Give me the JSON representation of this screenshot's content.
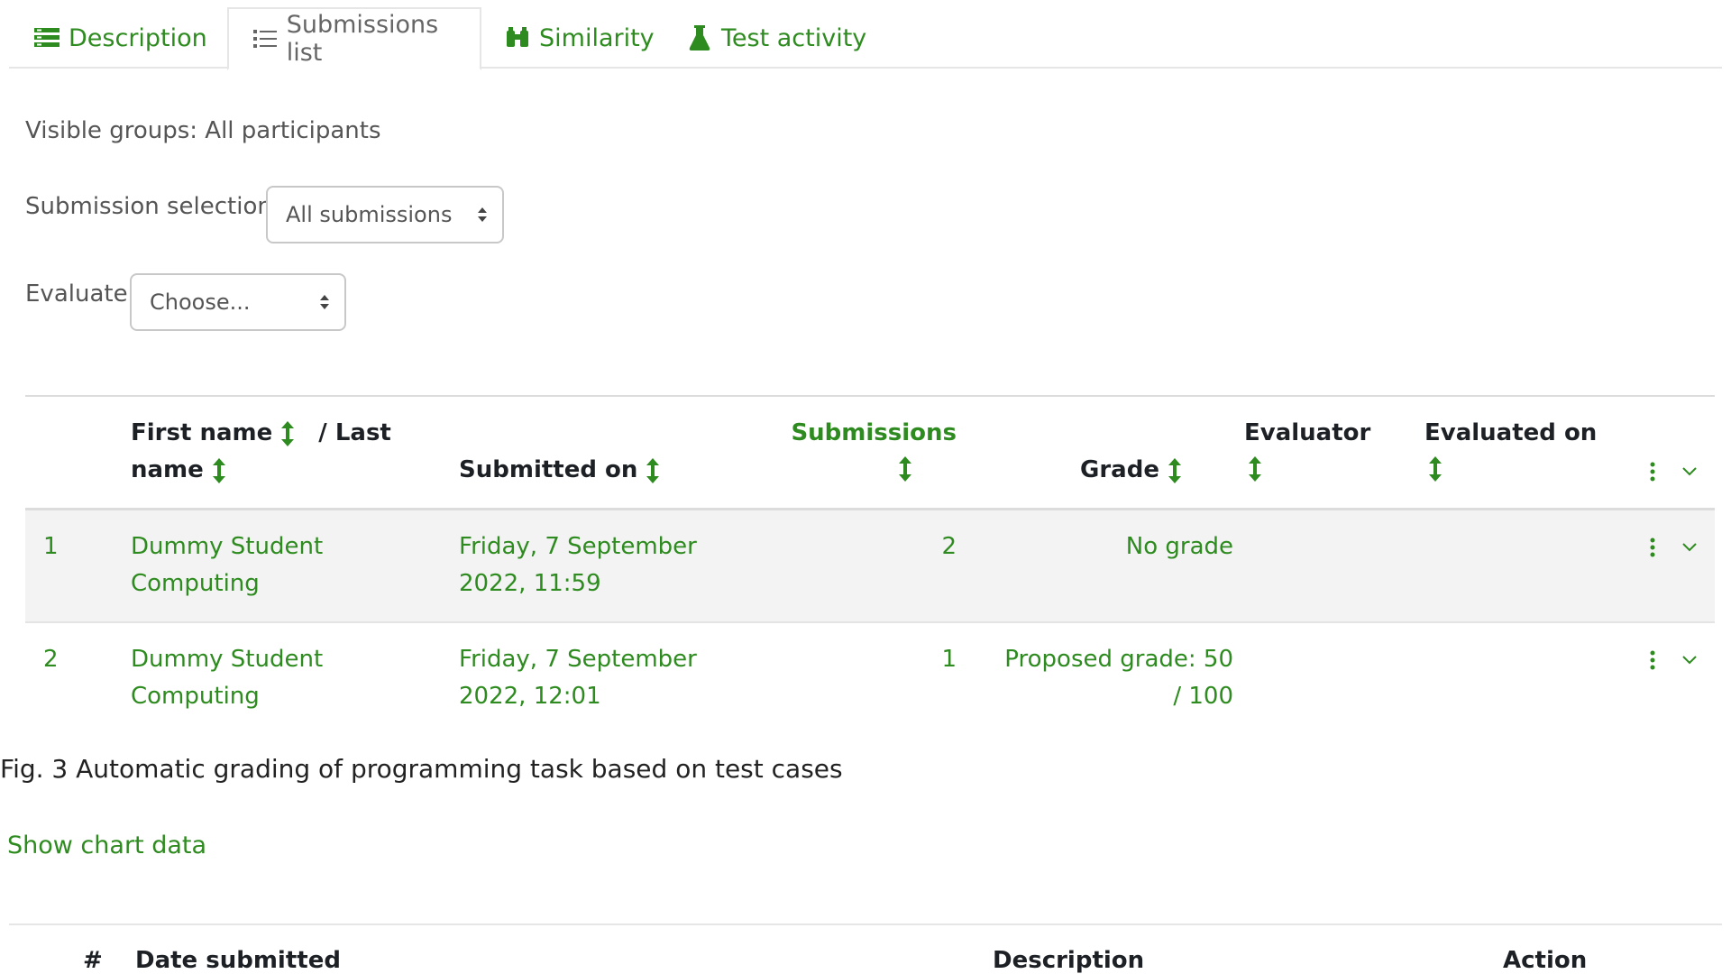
{
  "tabs": [
    {
      "label": "Description",
      "icon": "list-alt-icon"
    },
    {
      "label": "Submissions list",
      "icon": "list-icon"
    },
    {
      "label": "Similarity",
      "icon": "binoculars-icon"
    },
    {
      "label": "Test activity",
      "icon": "flask-icon"
    }
  ],
  "active_tab": "Submissions list",
  "groups": {
    "text": "Visible groups: All participants"
  },
  "submission_selection": {
    "label": "Submission selection",
    "value": "All submissions"
  },
  "evaluate": {
    "label": "Evaluate",
    "value": "Choose..."
  },
  "table": {
    "headers": {
      "first_name": "First name",
      "last_name": "/ Last",
      "last_name2": "name",
      "submitted_on": "Submitted on",
      "submissions": "Submissions",
      "grade": "Grade",
      "evaluator": "Evaluator",
      "evaluated_on": "Evaluated on"
    },
    "rows": [
      {
        "num": "1",
        "name1": "Dummy Student",
        "name2": "Computing",
        "date1": "Friday, 7 September",
        "date2": "2022, 11:59",
        "submissions": "2",
        "grade1": "No grade",
        "grade2": ""
      },
      {
        "num": "2",
        "name1": "Dummy Student",
        "name2": "Computing",
        "date1": "Friday, 7 September",
        "date2": "2022, 12:01",
        "submissions": "1",
        "grade1": "Proposed grade: 50",
        "grade2": "/ 100"
      }
    ]
  },
  "caption": "Fig. 3 Automatic grading of programming task based on test cases",
  "chart_link": "Show chart data",
  "second_table": {
    "headers": {
      "num": "#",
      "date": "Date submitted",
      "description": "Description",
      "action": "Action"
    }
  },
  "colors": {
    "accent": "#2e8b1f",
    "text": "#1d2125",
    "row_alt": "#f3f3f3"
  }
}
